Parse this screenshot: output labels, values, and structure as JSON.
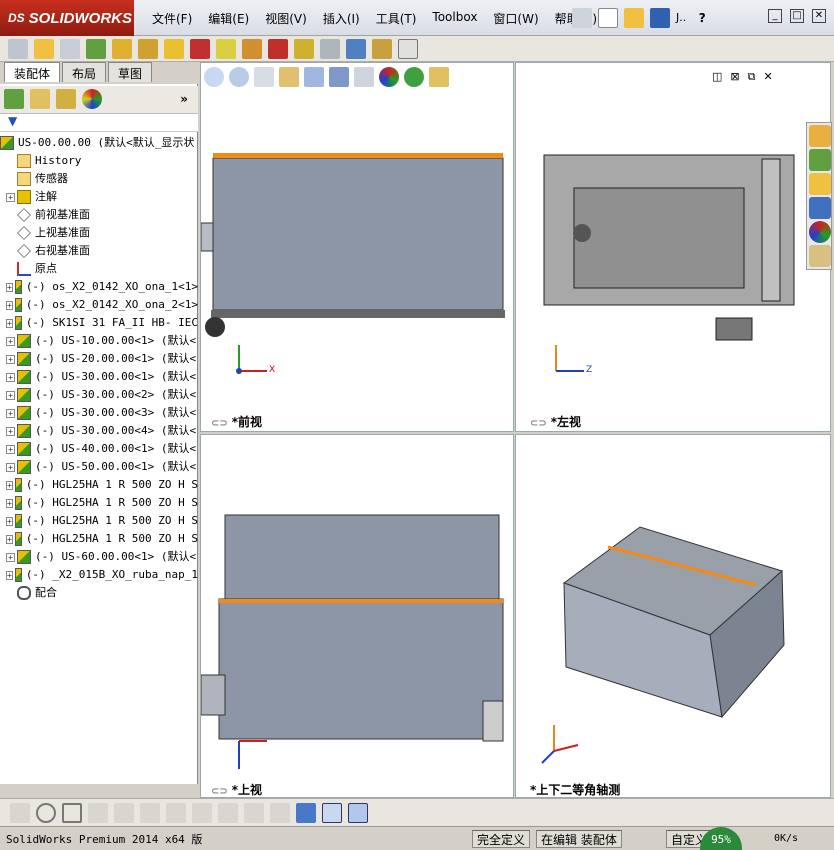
{
  "app": {
    "brand": "SOLIDWORKS",
    "brand_prefix": "DS"
  },
  "menu": [
    "文件(F)",
    "编辑(E)",
    "视图(V)",
    "插入(I)",
    "工具(T)",
    "Toolbox",
    "窗口(W)",
    "帮助(H)"
  ],
  "title_extra": "J..",
  "window_controls": [
    "_",
    "□",
    "✕"
  ],
  "tabs": [
    "装配体",
    "布局",
    "草图"
  ],
  "tree": {
    "root": "US-00.00.00  (默认<默认_显示状",
    "items": [
      {
        "label": "History",
        "icon": "history-icon",
        "expand": false
      },
      {
        "label": "传感器",
        "icon": "sensor-icon",
        "expand": false
      },
      {
        "label": "注解",
        "icon": "annotation-icon",
        "expand": true
      },
      {
        "label": "前视基准面",
        "icon": "plane-icon",
        "expand": false
      },
      {
        "label": "上视基准面",
        "icon": "plane-icon",
        "expand": false
      },
      {
        "label": "右视基准面",
        "icon": "plane-icon",
        "expand": false
      },
      {
        "label": "原点",
        "icon": "origin-icon",
        "expand": false
      },
      {
        "label": "(-) os_X2_0142_XO_ona_1<1>",
        "icon": "assembly-icon",
        "expand": true
      },
      {
        "label": "(-) os_X2_0142_XO_ona_2<1>",
        "icon": "assembly-icon",
        "expand": true
      },
      {
        "label": "(-) SK1SI 31 FA_II HB- IEC",
        "icon": "assembly-icon",
        "expand": true
      },
      {
        "label": "(-) US-10.00.00<1> (默认<",
        "icon": "assembly-icon",
        "expand": true
      },
      {
        "label": "(-) US-20.00.00<1> (默认<",
        "icon": "assembly-icon",
        "expand": true
      },
      {
        "label": "(-) US-30.00.00<1> (默认<",
        "icon": "assembly-icon",
        "expand": true
      },
      {
        "label": "(-) US-30.00.00<2> (默认<",
        "icon": "assembly-icon",
        "expand": true
      },
      {
        "label": "(-) US-30.00.00<3> (默认<",
        "icon": "assembly-icon",
        "expand": true
      },
      {
        "label": "(-) US-30.00.00<4> (默认<",
        "icon": "assembly-icon",
        "expand": true
      },
      {
        "label": "(-) US-40.00.00<1> (默认<",
        "icon": "assembly-icon",
        "expand": true
      },
      {
        "label": "(-) US-50.00.00<1> (默认<",
        "icon": "assembly-icon",
        "expand": true
      },
      {
        "label": "(-) HGL25HA 1 R 500 ZO H S",
        "icon": "assembly-icon",
        "expand": true
      },
      {
        "label": "(-) HGL25HA 1 R 500 ZO H S",
        "icon": "assembly-icon",
        "expand": true
      },
      {
        "label": "(-) HGL25HA 1 R 500 ZO H S",
        "icon": "assembly-icon",
        "expand": true
      },
      {
        "label": "(-) HGL25HA 1 R 500 ZO H S",
        "icon": "assembly-icon",
        "expand": true
      },
      {
        "label": "(-) US-60.00.00<1> (默认<",
        "icon": "assembly-icon",
        "expand": true
      },
      {
        "label": "(-) _X2_015B_XO_ruba_nap_1",
        "icon": "assembly-icon",
        "expand": true
      },
      {
        "label": "配合",
        "icon": "mates-icon",
        "expand": false
      }
    ]
  },
  "views": {
    "front": "*前视",
    "left": "*左视",
    "top": "*上视",
    "iso": "*上下二等角轴测"
  },
  "axes": {
    "x": "X",
    "y": "Y",
    "z": "Z"
  },
  "status": {
    "product": "SolidWorks Premium 2014 x64 版",
    "defined": "完全定义",
    "editing": "在编辑 装配体",
    "custom": "自定义",
    "progress": "95%",
    "speed": "0K/s"
  },
  "colors": {
    "accent_orange": "#f28a14",
    "body_gray": "#8d96a6",
    "brand_red": "#b82718"
  }
}
